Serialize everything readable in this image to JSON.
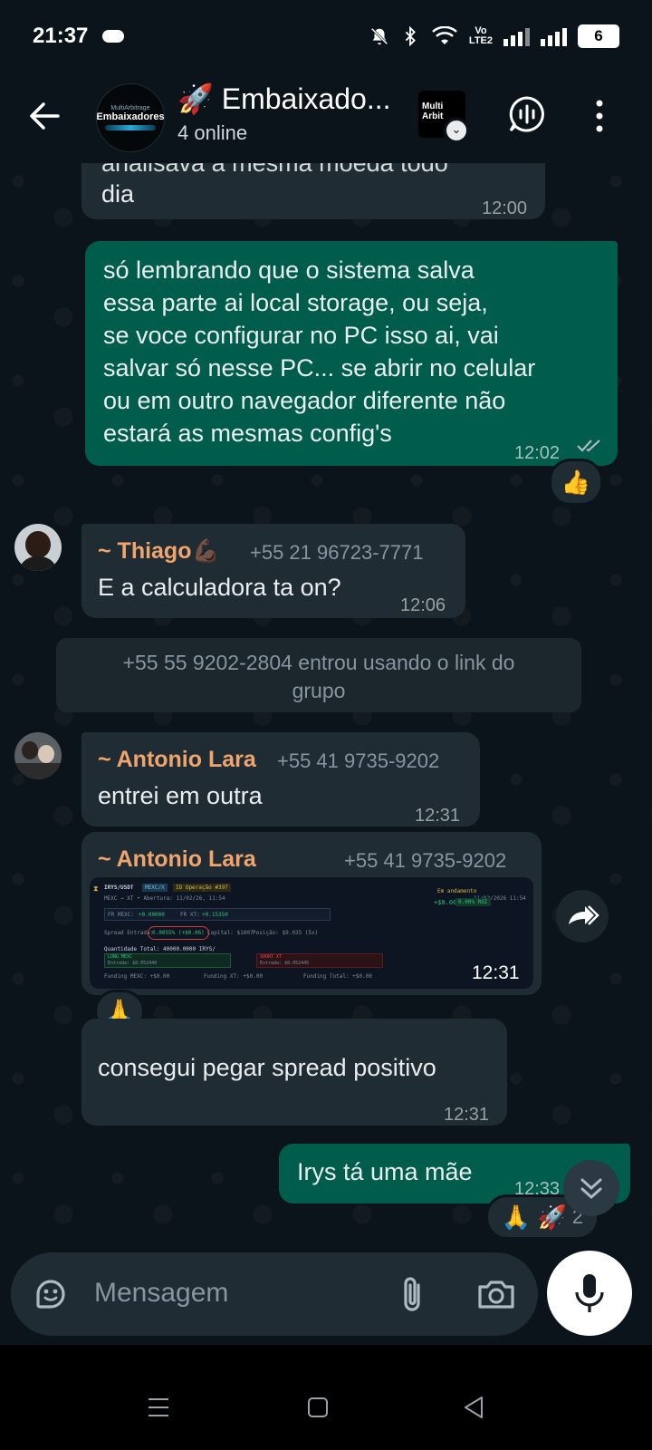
{
  "status_bar": {
    "time": "21:37",
    "network_label_top": "Vo",
    "network_label_bottom": "LTE2",
    "battery": "6"
  },
  "header": {
    "title": "🚀 Embaixado...",
    "subtitle": "4 online",
    "avatar_small_text": "MultiArbitrage",
    "avatar_text": "Embaixadores",
    "app_logo_text_1": "Multi",
    "app_logo_text_2": "Arbit"
  },
  "messages": {
    "m0": {
      "text_cut": "analisava a mesma moeda todo",
      "text": "dia",
      "time": "12:00"
    },
    "m1": {
      "lines": [
        "só lembrando que o sistema salva",
        "essa parte ai local storage, ou seja,",
        "se voce configurar no PC isso ai, vai",
        "salvar só nesse PC... se abrir no celular",
        "ou em outro navegador diferente não",
        "estará as mesmas config's"
      ],
      "time": "12:02",
      "reaction": "👍"
    },
    "m2": {
      "sender": "~ Thiago💪🏿",
      "phone": "+55 21 96723-7771",
      "text": "E a calculadora ta on?",
      "time": "12:06"
    },
    "system": {
      "line1": "+55 55 9202-2804 entrou usando o link do",
      "line2": "grupo"
    },
    "m3": {
      "sender": "~ Antonio Lara",
      "phone": "+55 41 9735-9202",
      "text": "entrei em outra",
      "time": "12:31"
    },
    "m4": {
      "sender": "~ Antonio Lara",
      "phone": "+55 41 9735-9202",
      "time": "12:31",
      "reaction": "🙏",
      "image": {
        "pair": "IRYS/USDT",
        "tag": "MEXC/X",
        "operation": "ID Operação #397",
        "exchanges": "MEXC → XT • Abertura: 11/02/26, 11:54",
        "status": "Em andamento",
        "datetime": "11/02/2026 11:54",
        "pnl": "+$0.00",
        "pnl_badge": "0.00% ROI",
        "fr_mexc_label": "FR MEXC:",
        "fr_mexc": "+0.00000",
        "fr_xt_label": "FR XT:",
        "fr_xt": "+0.15350",
        "spread_label": "Spread Entrada:",
        "spread": "0.0055% (+$0.06)",
        "capital": "Capital: $1007",
        "position": "Posição: $9.035 (5x)",
        "quantity": "Quantidade Total: 40000.0000 IRYS/",
        "long_label": "LONG MEXC",
        "long_entry": "Entrada: $0.052440",
        "short_label": "SHORT XT",
        "short_entry": "Entrada: $0.052445",
        "funding_mexc": "Funding MEXC: +$0.00",
        "funding_xt": "Funding XT: +$0.00",
        "funding_total": "Funding Total: +$0.00"
      }
    },
    "m5": {
      "text": "consegui pegar spread positivo",
      "time": "12:31"
    },
    "m6": {
      "text": "Irys tá uma mãe",
      "time": "12:33",
      "reaction_emojis": "🙏 🚀",
      "reaction_count": "2"
    }
  },
  "input": {
    "placeholder": "Mensagem"
  },
  "colors": {
    "outgoing": "#005c4b",
    "incoming": "#202c33",
    "background": "#0b141a",
    "sender_name": "#f0a56f"
  }
}
